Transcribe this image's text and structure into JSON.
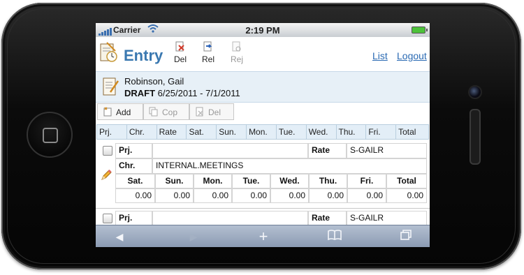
{
  "status_bar": {
    "carrier": "Carrier",
    "time": "2:19 PM",
    "wifi_icon": "wifi-icon",
    "battery_icon": "battery-icon"
  },
  "header": {
    "title": "Entry",
    "buttons": {
      "del": "Del",
      "rel": "Rel",
      "rej": "Rej"
    },
    "links": {
      "list": "List",
      "logout": "Logout"
    }
  },
  "info": {
    "name": "Robinson, Gail",
    "status": "DRAFT",
    "period": "6/25/2011 - 7/1/2011"
  },
  "actions": {
    "add": "Add",
    "cop": "Cop",
    "del": "Del"
  },
  "columns": [
    "Prj.",
    "Chr.",
    "Rate",
    "Sat.",
    "Sun.",
    "Mon.",
    "Tue.",
    "Wed.",
    "Thu.",
    "Fri.",
    "Total"
  ],
  "records": [
    {
      "prj_label": "Prj.",
      "prj_value": "",
      "rate_label": "Rate",
      "rate_value": "S-GAILR",
      "chr_label": "Chr.",
      "chr_value": "INTERNAL.MEETINGS",
      "days": [
        "Sat.",
        "Sun.",
        "Mon.",
        "Tue.",
        "Wed.",
        "Thu.",
        "Fri.",
        "Total"
      ],
      "values": [
        "0.00",
        "0.00",
        "0.00",
        "0.00",
        "0.00",
        "0.00",
        "0.00",
        "0.00"
      ]
    },
    {
      "prj_label": "Prj.",
      "prj_value": "",
      "rate_label": "Rate",
      "rate_value": "S-GAILR"
    }
  ],
  "browser_toolbar": {
    "back": "◀",
    "forward": "▶",
    "add": "+",
    "bookmarks": "📖",
    "pages": "⧉"
  },
  "colors": {
    "accent": "#3a78b0",
    "link": "#2a6ab3",
    "panel": "#e7f0f7",
    "toolbar": "#8a9ab2"
  }
}
